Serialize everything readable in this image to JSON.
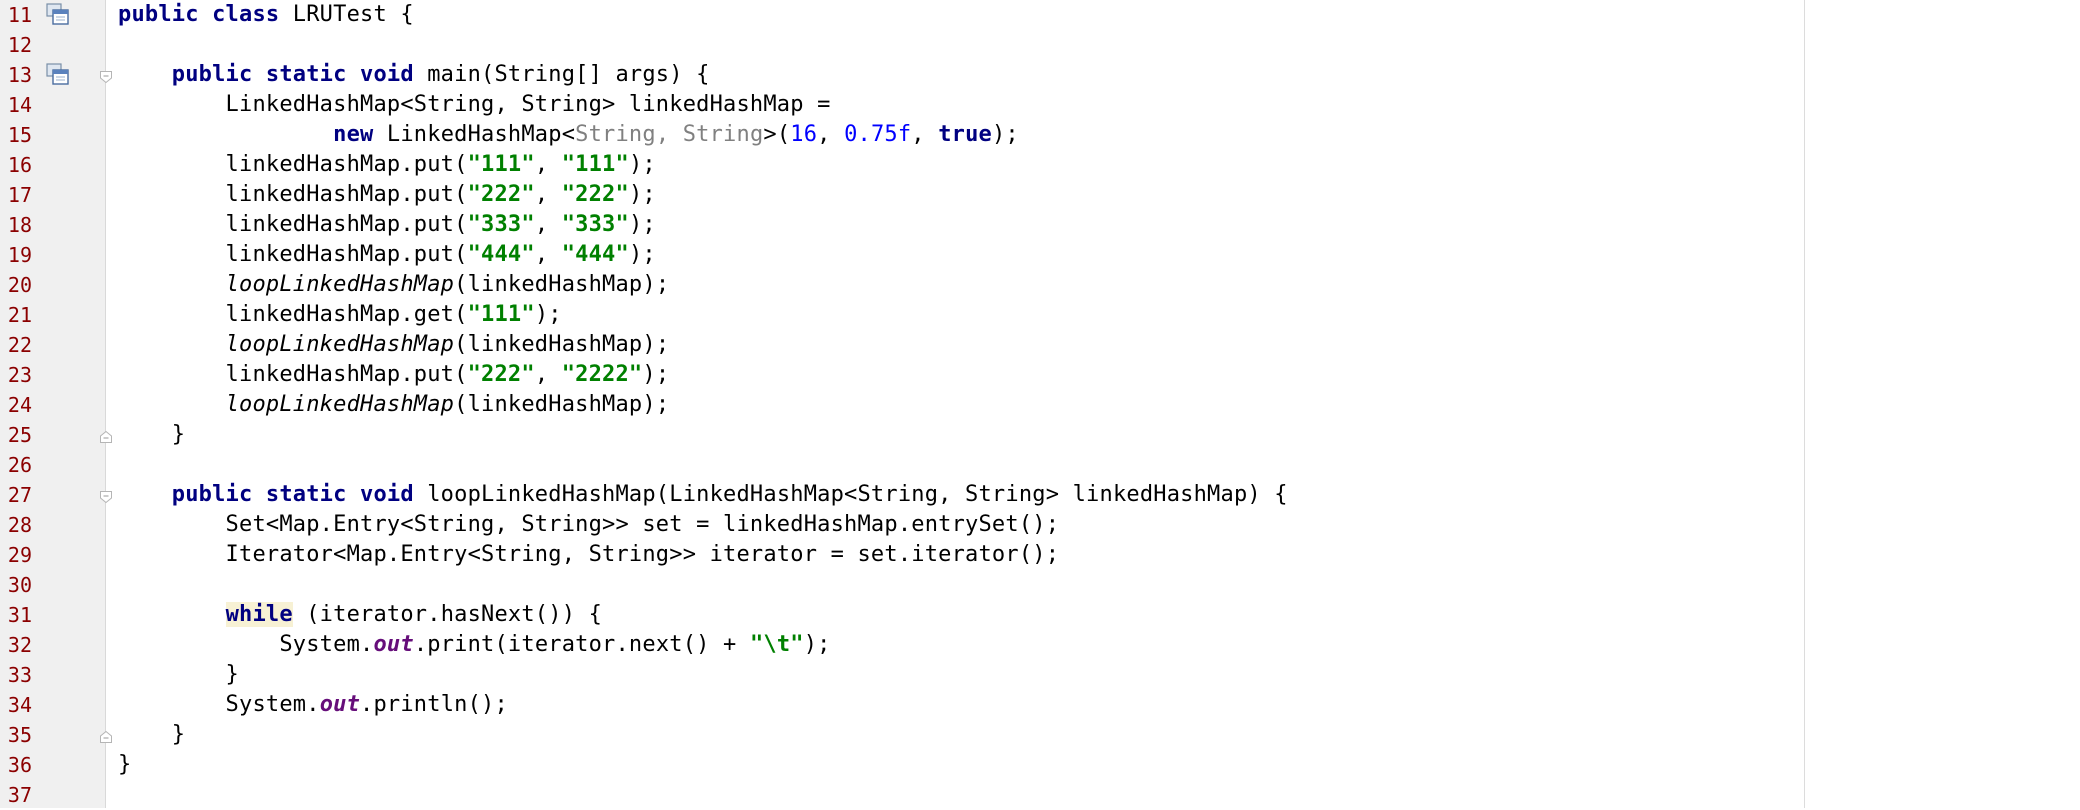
{
  "editor": {
    "language": "Java",
    "colors": {
      "keyword": "#000080",
      "string": "#008000",
      "number": "#0000FF",
      "static_field": "#660E7A",
      "line_number": "#8B0000",
      "gutter_bg": "#F0F0F0",
      "highlight_bg": "#F7F1D4"
    },
    "lines": [
      {
        "n": "11",
        "icon": "implemented-icon",
        "tokens": [
          {
            "t": "public class",
            "k": "kw"
          },
          {
            "t": " LRUTest {",
            "k": ""
          }
        ]
      },
      {
        "n": "12",
        "tokens": []
      },
      {
        "n": "13",
        "icon": "implemented-icon",
        "fold": "fold-open-icon",
        "tokens": [
          {
            "t": "    ",
            "k": ""
          },
          {
            "t": "public static void",
            "k": "kw"
          },
          {
            "t": " main(String[] args) {",
            "k": ""
          }
        ]
      },
      {
        "n": "14",
        "tokens": [
          {
            "t": "        LinkedHashMap<String, String> linkedHashMap =",
            "k": ""
          }
        ]
      },
      {
        "n": "15",
        "tokens": [
          {
            "t": "                ",
            "k": ""
          },
          {
            "t": "new",
            "k": "kw"
          },
          {
            "t": " LinkedHashMap<",
            "k": ""
          },
          {
            "t": "String, String",
            "k": "type-hint"
          },
          {
            "t": ">(",
            "k": ""
          },
          {
            "t": "16",
            "k": "num"
          },
          {
            "t": ", ",
            "k": ""
          },
          {
            "t": "0.75f",
            "k": "num"
          },
          {
            "t": ", ",
            "k": ""
          },
          {
            "t": "true",
            "k": "kw"
          },
          {
            "t": ");",
            "k": ""
          }
        ]
      },
      {
        "n": "16",
        "tokens": [
          {
            "t": "        linkedHashMap.put(",
            "k": ""
          },
          {
            "t": "\"111\"",
            "k": "str"
          },
          {
            "t": ", ",
            "k": ""
          },
          {
            "t": "\"111\"",
            "k": "str"
          },
          {
            "t": ");",
            "k": ""
          }
        ]
      },
      {
        "n": "17",
        "tokens": [
          {
            "t": "        linkedHashMap.put(",
            "k": ""
          },
          {
            "t": "\"222\"",
            "k": "str"
          },
          {
            "t": ", ",
            "k": ""
          },
          {
            "t": "\"222\"",
            "k": "str"
          },
          {
            "t": ");",
            "k": ""
          }
        ]
      },
      {
        "n": "18",
        "tokens": [
          {
            "t": "        linkedHashMap.put(",
            "k": ""
          },
          {
            "t": "\"333\"",
            "k": "str"
          },
          {
            "t": ", ",
            "k": ""
          },
          {
            "t": "\"333\"",
            "k": "str"
          },
          {
            "t": ");",
            "k": ""
          }
        ]
      },
      {
        "n": "19",
        "tokens": [
          {
            "t": "        linkedHashMap.put(",
            "k": ""
          },
          {
            "t": "\"444\"",
            "k": "str"
          },
          {
            "t": ", ",
            "k": ""
          },
          {
            "t": "\"444\"",
            "k": "str"
          },
          {
            "t": ");",
            "k": ""
          }
        ]
      },
      {
        "n": "20",
        "tokens": [
          {
            "t": "        ",
            "k": ""
          },
          {
            "t": "loopLinkedHashMap",
            "k": "static-call"
          },
          {
            "t": "(linkedHashMap);",
            "k": ""
          }
        ]
      },
      {
        "n": "21",
        "tokens": [
          {
            "t": "        linkedHashMap.get(",
            "k": ""
          },
          {
            "t": "\"111\"",
            "k": "str"
          },
          {
            "t": ");",
            "k": ""
          }
        ]
      },
      {
        "n": "22",
        "tokens": [
          {
            "t": "        ",
            "k": ""
          },
          {
            "t": "loopLinkedHashMap",
            "k": "static-call"
          },
          {
            "t": "(linkedHashMap);",
            "k": ""
          }
        ]
      },
      {
        "n": "23",
        "tokens": [
          {
            "t": "        linkedHashMap.put(",
            "k": ""
          },
          {
            "t": "\"222\"",
            "k": "str"
          },
          {
            "t": ", ",
            "k": ""
          },
          {
            "t": "\"2222\"",
            "k": "str"
          },
          {
            "t": ");",
            "k": ""
          }
        ]
      },
      {
        "n": "24",
        "tokens": [
          {
            "t": "        ",
            "k": ""
          },
          {
            "t": "loopLinkedHashMap",
            "k": "static-call"
          },
          {
            "t": "(linkedHashMap);",
            "k": ""
          }
        ]
      },
      {
        "n": "25",
        "fold": "fold-close-icon",
        "tokens": [
          {
            "t": "    }",
            "k": ""
          }
        ]
      },
      {
        "n": "26",
        "tokens": []
      },
      {
        "n": "27",
        "fold": "fold-open-icon",
        "tokens": [
          {
            "t": "    ",
            "k": ""
          },
          {
            "t": "public static void",
            "k": "kw"
          },
          {
            "t": " loopLinkedHashMap(LinkedHashMap<String, String> linkedHashMap) {",
            "k": ""
          }
        ]
      },
      {
        "n": "28",
        "tokens": [
          {
            "t": "        Set<Map.Entry<String, String>> set = linkedHashMap.entrySet();",
            "k": ""
          }
        ]
      },
      {
        "n": "29",
        "tokens": [
          {
            "t": "        Iterator<Map.Entry<String, String>> iterator = set.iterator();",
            "k": ""
          }
        ]
      },
      {
        "n": "30",
        "tokens": []
      },
      {
        "n": "31",
        "tokens": [
          {
            "t": "        ",
            "k": ""
          },
          {
            "t": "while",
            "k": "kw hl"
          },
          {
            "t": " (iterator.hasNext()) {",
            "k": ""
          }
        ]
      },
      {
        "n": "32",
        "tokens": [
          {
            "t": "            System.",
            "k": ""
          },
          {
            "t": "out",
            "k": "static-field"
          },
          {
            "t": ".print(iterator.next() + ",
            "k": ""
          },
          {
            "t": "\"\\t\"",
            "k": "str"
          },
          {
            "t": ");",
            "k": ""
          }
        ]
      },
      {
        "n": "33",
        "tokens": [
          {
            "t": "        }",
            "k": ""
          }
        ]
      },
      {
        "n": "34",
        "tokens": [
          {
            "t": "        System.",
            "k": ""
          },
          {
            "t": "out",
            "k": "static-field"
          },
          {
            "t": ".println();",
            "k": ""
          }
        ]
      },
      {
        "n": "35",
        "fold": "fold-close-icon",
        "tokens": [
          {
            "t": "    }",
            "k": ""
          }
        ]
      },
      {
        "n": "36",
        "tokens": [
          {
            "t": "}",
            "k": ""
          }
        ]
      },
      {
        "n": "37",
        "tokens": []
      }
    ]
  }
}
